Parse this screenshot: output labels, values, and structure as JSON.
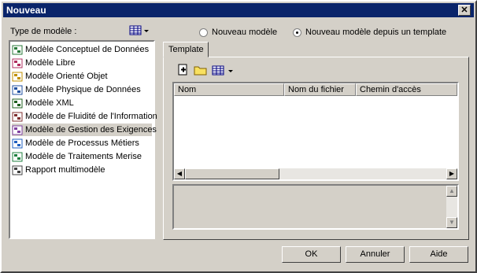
{
  "window": {
    "title": "Nouveau",
    "close": "✕"
  },
  "type_label": "Type de modèle :",
  "model_types": [
    {
      "label": "Modèle Conceptuel de Données",
      "icon": "mcd-icon",
      "color": "#2a7a3a"
    },
    {
      "label": "Modèle Libre",
      "icon": "free-model-icon",
      "color": "#b03060"
    },
    {
      "label": "Modèle Orienté Objet",
      "icon": "oom-icon",
      "color": "#c09000"
    },
    {
      "label": "Modèle Physique de Données",
      "icon": "mpd-icon",
      "color": "#2050a0"
    },
    {
      "label": "Modèle XML",
      "icon": "xml-icon",
      "color": "#206020"
    },
    {
      "label": "Modèle de Fluidité de l'Information",
      "icon": "flow-icon",
      "color": "#803030"
    },
    {
      "label": "Modèle de Gestion des Exigences",
      "icon": "requirements-icon",
      "color": "#8040a0"
    },
    {
      "label": "Modèle de Processus Métiers",
      "icon": "process-icon",
      "color": "#2060c0"
    },
    {
      "label": "Modèle de Traitements Merise",
      "icon": "merise-icon",
      "color": "#208040"
    },
    {
      "label": "Rapport multimodèle",
      "icon": "report-icon",
      "color": "#404040"
    }
  ],
  "selected_index": 6,
  "options": {
    "new_model": "Nouveau modèle",
    "from_template": "Nouveau modèle depuis un template",
    "selected": "from_template"
  },
  "tab_label": "Template",
  "columns": [
    "Nom",
    "Nom du fichier",
    "Chemin d'accès"
  ],
  "buttons": {
    "ok": "OK",
    "cancel": "Annuler",
    "help": "Aide"
  }
}
